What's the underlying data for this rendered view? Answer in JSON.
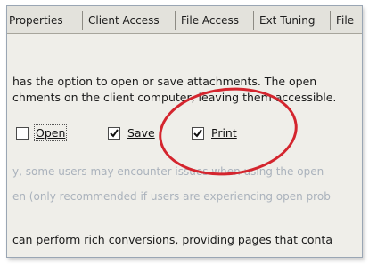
{
  "tabs": [
    "Properties",
    "Client Access",
    "File Access",
    "Ext Tuning",
    "File"
  ],
  "description": {
    "line1": "has the option to open or save attachments. The open",
    "line2": "chments on the client computer, leaving them accessible."
  },
  "options": {
    "open": {
      "label": "Open",
      "checked": false
    },
    "save": {
      "label": "Save",
      "checked": true
    },
    "print": {
      "label": "Print",
      "checked": true
    }
  },
  "faded_text": {
    "line1": "y, some users may encounter issues when using the open",
    "line2": "en (only recommended if users are experiencing open prob"
  },
  "footer_text": "can perform rich conversions, providing pages that conta",
  "colors": {
    "annotation_circle": "#d4252e"
  }
}
